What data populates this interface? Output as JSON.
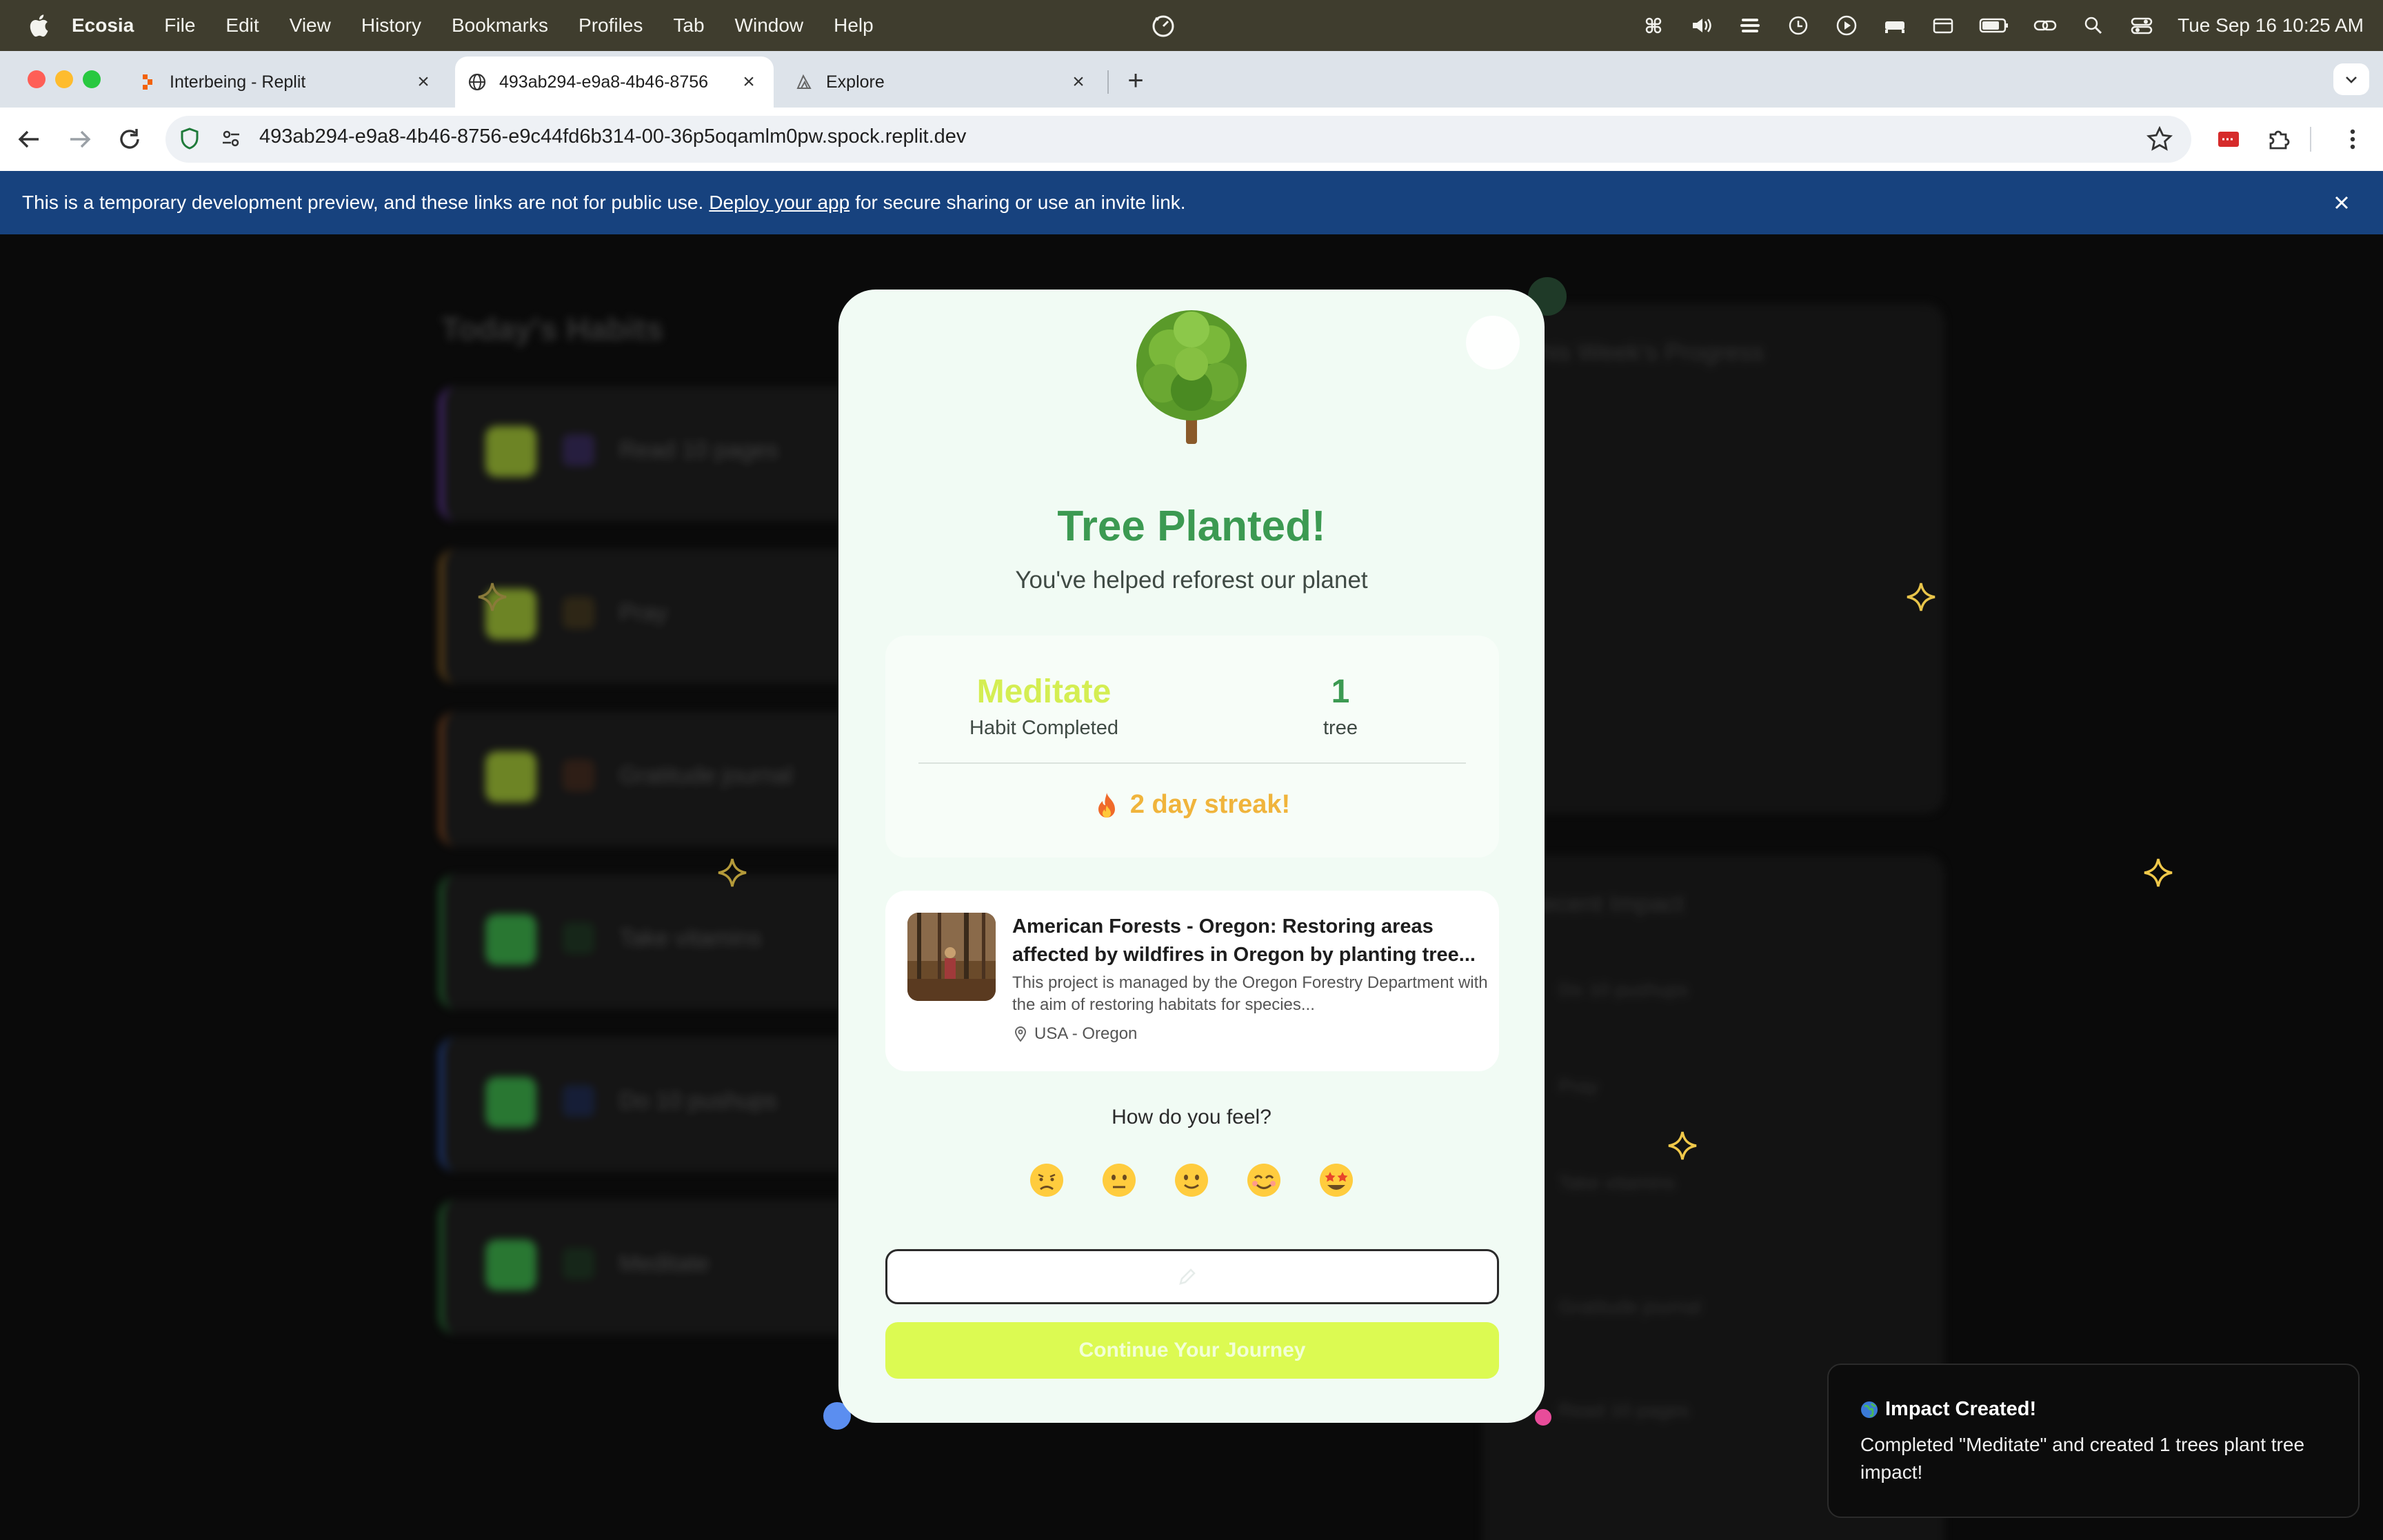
{
  "menubar": {
    "app": "Ecosia",
    "items": [
      "File",
      "Edit",
      "View",
      "History",
      "Bookmarks",
      "Profiles",
      "Tab",
      "Window",
      "Help"
    ],
    "clock": "Tue Sep 16  10:25 AM"
  },
  "browser": {
    "tabs": [
      {
        "title": "Interbeing - Replit",
        "icon": "replit-icon"
      },
      {
        "title": "493ab294-e9a8-4b46-8756",
        "icon": "globe-icon"
      },
      {
        "title": "Explore",
        "icon": "explore-icon"
      }
    ],
    "url": "493ab294-e9a8-4b46-8756-e9c44fd6b314-00-36p5oqamlm0pw.spock.replit.dev"
  },
  "banner": {
    "text_before": "This is a temporary development preview, and these links are not for public use.",
    "link": "Deploy your app",
    "text_after": "for secure sharing or use an invite link."
  },
  "modal": {
    "title": "Tree Planted!",
    "subtitle": "You've helped reforest our planet",
    "habit": "Meditate",
    "habit_label": "Habit Completed",
    "count": "1",
    "count_label": "tree",
    "streak": "2 day streak!",
    "project": {
      "title": "American Forests - Oregon: Restoring areas affected by wildfires in Oregon by planting tree...",
      "description": "This project is managed by the Oregon Forestry Department with the aim of restoring habitats for species...",
      "location": "USA - Oregon"
    },
    "feel_question": "How do you feel?",
    "moods": [
      "disappointed-face-icon",
      "neutral-face-icon",
      "slightly-smiling-face-icon",
      "smiling-face-icon",
      "star-struck-face-icon"
    ],
    "continue_label": "Continue Your Journey"
  },
  "toast": {
    "title": "Impact Created!",
    "body": "Completed \"Meditate\" and created 1 trees plant tree impact!"
  },
  "colors": {
    "modal_bg": "#f1fbf4",
    "title_green": "#3c9a52",
    "accent_lime": "#dcfa52",
    "streak_orange": "#f0b43c",
    "banner_blue": "#17427e"
  }
}
